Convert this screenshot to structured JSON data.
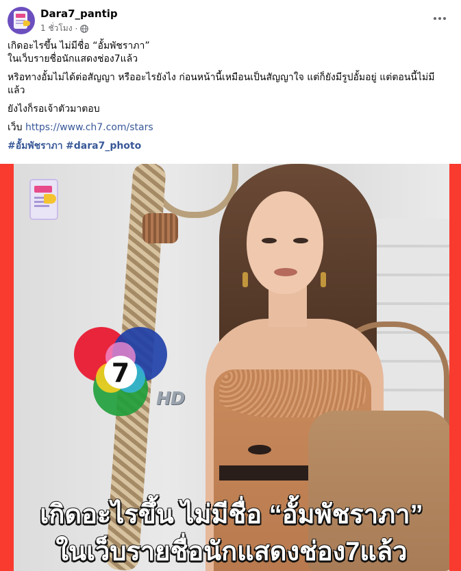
{
  "post": {
    "page_name": "Dara7_pantip",
    "timestamp": "1 ชั่วโมง",
    "separator": "·",
    "icons": {
      "privacy": "globe-icon",
      "menu": "more-options-icon"
    },
    "text": {
      "line1": "เกิดอะไรขึ้น ไม่มีชื่อ “อั้มพัชราภา”",
      "line2": "ในเว็บรายชื่อนักแสดงช่อง7แล้ว",
      "paragraph2": "หริอทางอั้มไม่ได้ต่อสัญญา หรืออะไรยังไง ก่อนหน้านี้เหมือนเป็นสัญญาใจ แต่ก็ยังมีรูปอั้มอยู่ แต่ตอนนี้ไม่มีแล้ว",
      "paragraph3": "ยังไงก็รอเจ้าตัวมาตอบ",
      "web_label": "เว็บ",
      "web_link": "https://www.ch7.com/stars",
      "hashtags": [
        "#อั้มพัชราภา",
        "#dara7_photo"
      ]
    },
    "image": {
      "frame_color": "#f93a2f",
      "channel_number": "7",
      "hd_label": "HD",
      "caption_line1": "เกิดอะไรขึ้น ไม่มีชื่อ “อั้มพัชราภา”",
      "caption_line2": "ในเว็บรายชื่อนักแสดงช่อง7แล้ว"
    }
  }
}
